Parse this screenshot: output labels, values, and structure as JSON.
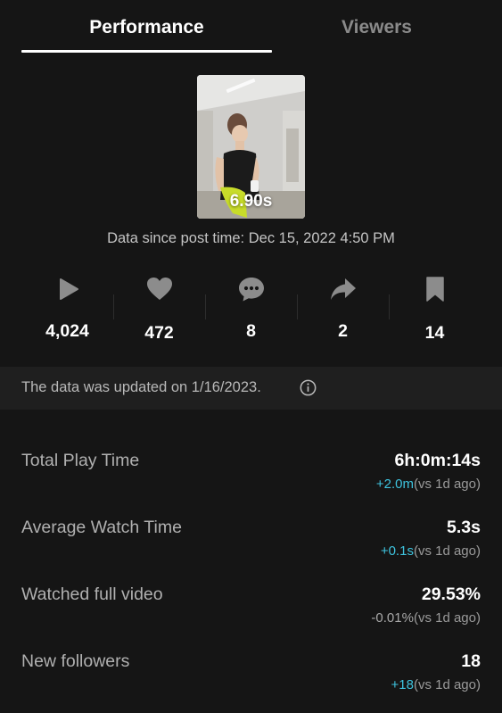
{
  "tabs": {
    "performance": "Performance",
    "viewers": "Viewers"
  },
  "video": {
    "duration": "6.90s"
  },
  "data_since": "Data since post time: Dec 15, 2022 4:50 PM",
  "stats": {
    "plays": {
      "icon": "play-icon",
      "value": "4,024"
    },
    "likes": {
      "icon": "heart-icon",
      "value": "472"
    },
    "comments": {
      "icon": "comment-icon",
      "value": "8"
    },
    "shares": {
      "icon": "share-icon",
      "value": "2"
    },
    "saves": {
      "icon": "bookmark-icon",
      "value": "14"
    }
  },
  "update_notice": "The data was updated on 1/16/2023.",
  "metrics": {
    "total_play_time": {
      "label": "Total Play Time",
      "value": "6h:0m:14s",
      "delta": "+2.0m",
      "vs": "(vs 1d ago)"
    },
    "average_watch_time": {
      "label": "Average Watch Time",
      "value": "5.3s",
      "delta": "+0.1s",
      "vs": "(vs 1d ago)"
    },
    "watched_full_video": {
      "label": "Watched full video",
      "value": "29.53%",
      "delta": "-0.01%",
      "vs": "(vs 1d ago)"
    },
    "new_followers": {
      "label": "New followers",
      "value": "18",
      "delta": "+18",
      "vs": "(vs 1d ago)"
    }
  },
  "colors": {
    "background": "#151515",
    "positive_delta": "#3ec3de",
    "neutral_delta": "#a8a8a8"
  }
}
